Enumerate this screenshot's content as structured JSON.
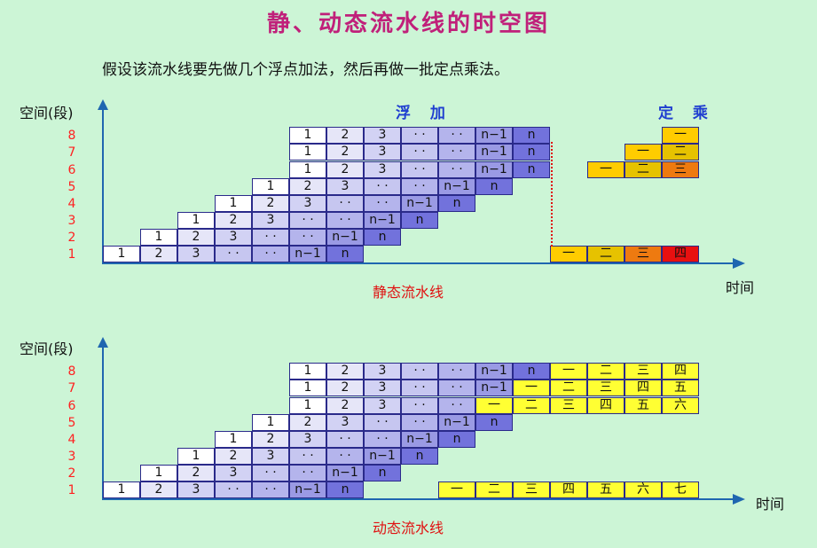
{
  "title": "静、动态流水线的时空图",
  "subtitle": "假设该流水线要先做几个浮点加法，然后再做一批定点乘法。",
  "axis": {
    "y_label": "空间(段)",
    "x_label": "时间"
  },
  "segments": [
    "1",
    "2",
    "3",
    "4",
    "5",
    "6",
    "7",
    "8"
  ],
  "ops": {
    "add": "浮 加",
    "mul": "定 乘"
  },
  "static": {
    "caption": "静态流水线"
  },
  "dynamic": {
    "caption": "动态流水线"
  },
  "labels": {
    "add_tasks": [
      "1",
      "2",
      "3",
      "· ·",
      "· ·",
      "n−1",
      "n"
    ],
    "mul_tasks": [
      "一",
      "二",
      "三",
      "四",
      "五",
      "六",
      "七"
    ]
  },
  "colors": {
    "add_gradient": [
      "#ffffff",
      "#e6e6f8",
      "#d2d2f4",
      "#c6c6f0",
      "#b4b4ec",
      "#9a9ae4",
      "#7272dc"
    ],
    "static_mul": [
      "#ffcc00",
      "#e6c200",
      "#ee7a10",
      "#e81010"
    ],
    "dynamic_mul": "#ffff33"
  },
  "chart_data": {
    "type": "table",
    "pipelines": [
      {
        "name": "静态流水线",
        "add_stage_starts": [
          0,
          1,
          2,
          3,
          4,
          5,
          5,
          5
        ],
        "add_tasks": 7,
        "mul_stages_shown": [
          1,
          6,
          7,
          8
        ],
        "mul_tasks_static": [
          "一",
          "二",
          "三",
          "四"
        ]
      },
      {
        "name": "动态流水线",
        "add_stage_starts": [
          0,
          1,
          2,
          3,
          4,
          5,
          5,
          5
        ],
        "add_tasks": 7,
        "mul_tasks_dynamic": [
          "一",
          "二",
          "三",
          "四",
          "五",
          "六",
          "七"
        ]
      }
    ]
  }
}
